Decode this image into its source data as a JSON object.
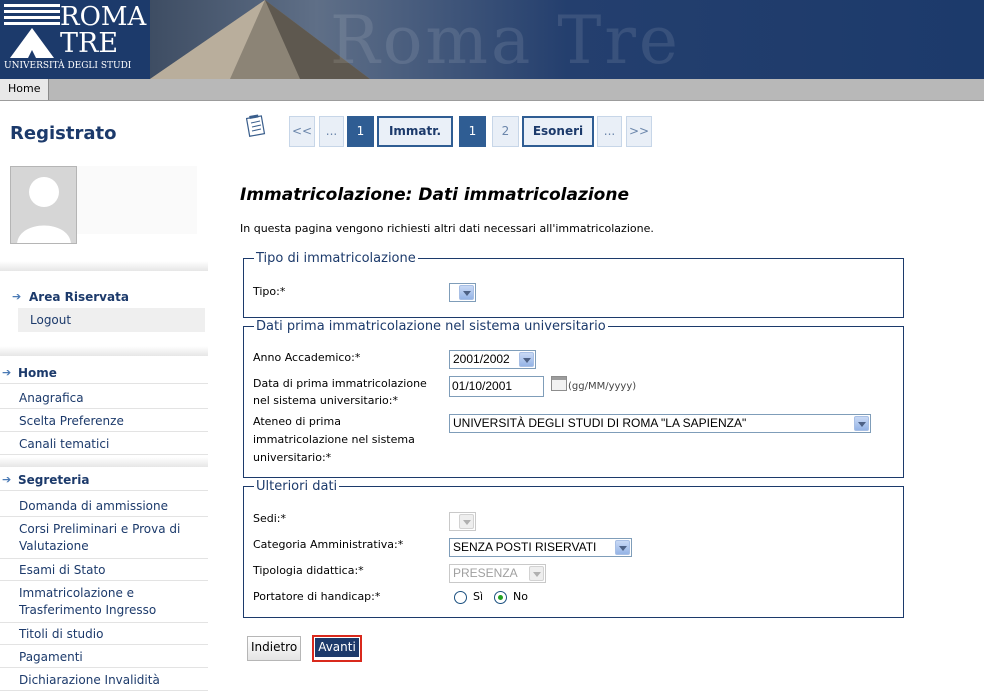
{
  "header": {
    "logo_line1": "ROMA",
    "logo_line2": "TRE",
    "logo_sub": "UNIVERSITÀ DEGLI STUDI",
    "watermark": "Roma Tre"
  },
  "nav": {
    "home": "Home"
  },
  "sidebar": {
    "title": "Registrato",
    "area_riservata": "Area Riservata",
    "logout": "Logout",
    "home": "Home",
    "home_items": [
      "Anagrafica",
      "Scelta Preferenze",
      "Canali tematici"
    ],
    "segreteria": "Segreteria",
    "segreteria_items": [
      "Domanda di ammissione",
      "Corsi Preliminari e Prova di Valutazione",
      "Esami di Stato",
      "Immatricolazione e Trasferimento Ingresso",
      "Titoli di studio",
      "Pagamenti",
      "Dichiarazione Invalidità"
    ]
  },
  "pager": {
    "first": "<<",
    "dots": "...",
    "step_prev": "1",
    "immatr": "Immatr.",
    "current": "1",
    "next_num": "2",
    "esoneri": "Esoneri",
    "last": ">>"
  },
  "main": {
    "title": "Immatricolazione: Dati immatricolazione",
    "intro": "In questa pagina vengono richiesti altri dati necessari all'immatricolazione."
  },
  "section_tipo": {
    "legend": "Tipo di immatricolazione",
    "tipo_label": "Tipo:*",
    "tipo_value": ""
  },
  "section_prima": {
    "legend": "Dati prima immatricolazione nel sistema universitario",
    "anno_label": "Anno Accademico:*",
    "anno_value": "2001/2002",
    "data_label_1": "Data di prima immatricolazione",
    "data_label_2": "nel sistema universitario:*",
    "data_value": "01/10/2001",
    "data_format": "(gg/MM/yyyy)",
    "ateneo_label_1": "Ateneo di prima",
    "ateneo_label_2": "immatricolazione nel sistema",
    "ateneo_label_3": "universitario:*",
    "ateneo_value": "UNIVERSITÀ DEGLI STUDI DI ROMA \"LA SAPIENZA\""
  },
  "section_ulteriori": {
    "legend": "Ulteriori dati",
    "sedi_label": "Sedi:*",
    "sedi_value": "",
    "categoria_label": "Categoria Amministrativa:*",
    "categoria_value": "SENZA POSTI RISERVATI",
    "tipologia_label": "Tipologia didattica:*",
    "tipologia_value": "PRESENZA",
    "handicap_label": "Portatore di handicap:*",
    "handicap_si": "Sì",
    "handicap_no": "No",
    "handicap_selected": "No"
  },
  "buttons": {
    "back": "Indietro",
    "next": "Avanti"
  },
  "colors": {
    "brand": "#1c3a6b",
    "accent_border": "#d9291c"
  }
}
